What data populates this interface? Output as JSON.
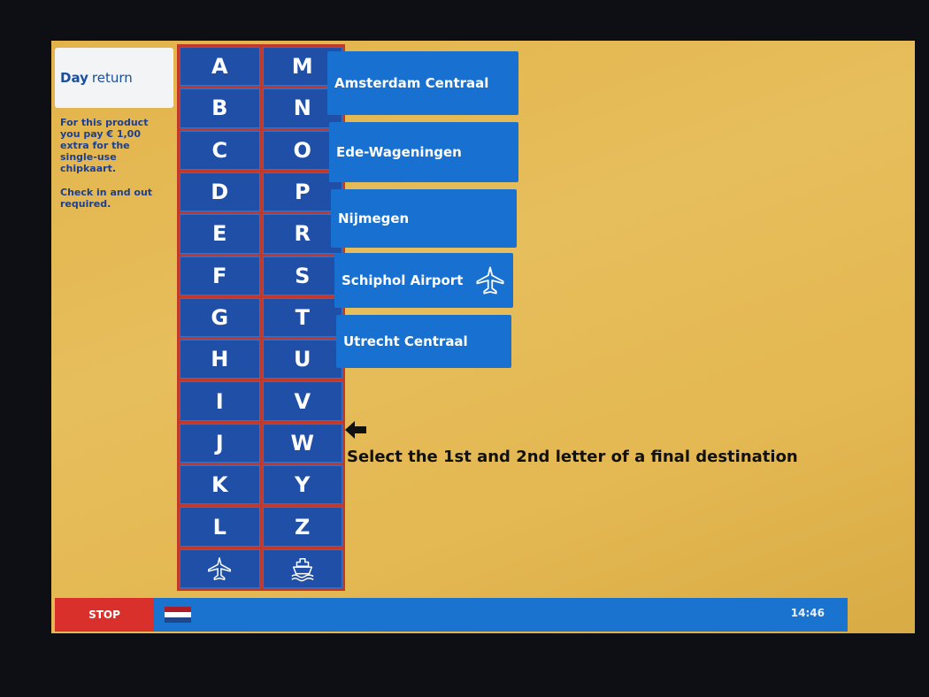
{
  "product": {
    "tab_label_bold": "Day",
    "tab_label_rest": "return",
    "info_line1": "For this product you pay € 1,00 extra for the single-use chipkaart.",
    "info_line2": "Check in and out required."
  },
  "letters": {
    "left": [
      "A",
      "B",
      "C",
      "D",
      "E",
      "F",
      "G",
      "H",
      "I",
      "J",
      "K",
      "L"
    ],
    "right": [
      "M",
      "N",
      "O",
      "P",
      "R",
      "S",
      "T",
      "U",
      "V",
      "W",
      "Y",
      "Z"
    ],
    "bottom_left_icon": "airplane-icon",
    "bottom_right_icon": "ferry-icon"
  },
  "destinations": [
    {
      "label": "Amsterdam Centraal"
    },
    {
      "label": "Ede-Wageningen"
    },
    {
      "label": "Nijmegen"
    },
    {
      "label": "Schiphol Airport",
      "icon": "airplane-icon"
    },
    {
      "label": "Utrecht Centraal"
    }
  ],
  "instruction": "Select the 1st and 2nd letter of a final destination",
  "footer": {
    "stop_label": "STOP",
    "language_icon": "dutch-flag-icon",
    "time": "14:46"
  },
  "colors": {
    "background": "#e3b34a",
    "key_blue": "#1f4fa6",
    "grid_border": "#c0392b",
    "destination_blue": "#1870d0",
    "stop_red": "#d9302b",
    "footer_blue": "#1a74cf"
  }
}
